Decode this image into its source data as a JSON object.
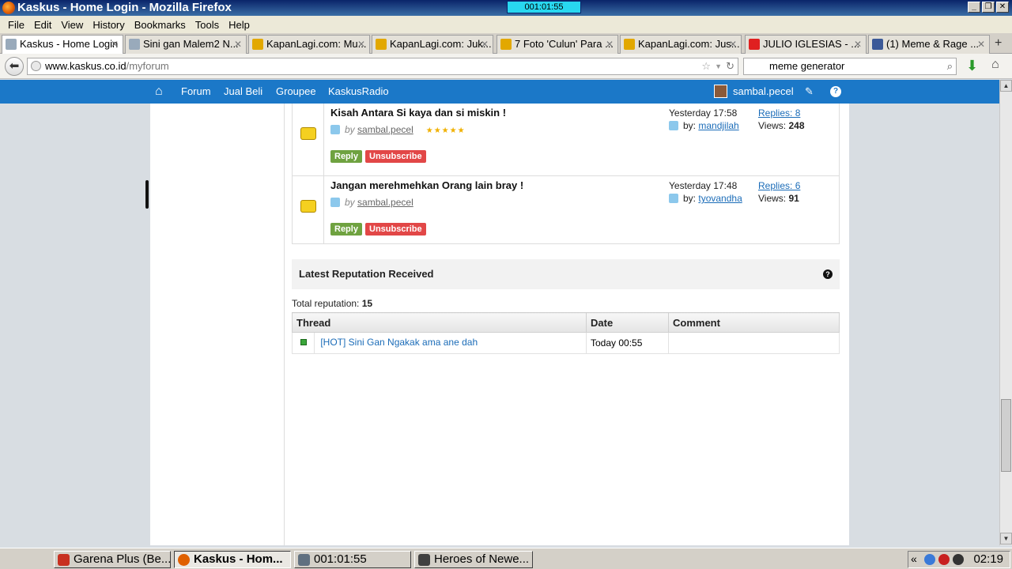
{
  "window": {
    "title": "Kaskus - Home Login - Mozilla Firefox",
    "timer": "001:01:55"
  },
  "menu": [
    "File",
    "Edit",
    "View",
    "History",
    "Bookmarks",
    "Tools",
    "Help"
  ],
  "tabs": [
    {
      "label": "Kaskus - Home Login",
      "icon": "kaskus-icon",
      "color": "#9ab"
    },
    {
      "label": "Sini gan Malem2 N...",
      "icon": "kaskus-icon",
      "color": "#9ab"
    },
    {
      "label": "KapanLagi.com: Mu...",
      "icon": "kapanlagi-icon",
      "color": "#e2a800"
    },
    {
      "label": "KapanLagi.com: Juk...",
      "icon": "kapanlagi-icon",
      "color": "#e2a800"
    },
    {
      "label": "7 Foto 'Culun' Para ...",
      "icon": "kapanlagi-icon",
      "color": "#e2a800"
    },
    {
      "label": "KapanLagi.com: Jus...",
      "icon": "kapanlagi-icon",
      "color": "#e2a800"
    },
    {
      "label": "JULIO IGLESIAS - ...",
      "icon": "youtube-icon",
      "color": "#e02020"
    },
    {
      "label": "(1) Meme & Rage ...",
      "icon": "facebook-icon",
      "color": "#3b5998"
    }
  ],
  "nav": {
    "url_host": "www.kaskus.co.id",
    "url_path": "/myforum",
    "search_value": "meme generator"
  },
  "kaskus_nav": {
    "items": [
      "Forum",
      "Jual Beli",
      "Groupee",
      "KaskusRadio"
    ],
    "username": "sambal.pecel"
  },
  "threads": [
    {
      "title": "Kisah Antara Si kaya dan si miskin !",
      "by_prefix": "by",
      "author": "sambal.pecel",
      "stars": "★★★★★",
      "reply": "Reply",
      "unsubscribe": "Unsubscribe",
      "date": "Yesterday 17:58",
      "last_by_prefix": "by:",
      "last_by": "mandjilah",
      "replies": "Replies: 8",
      "views_label": "Views:",
      "views": "248"
    },
    {
      "title": "Jangan merehmehkan Orang lain bray !",
      "by_prefix": "by",
      "author": "sambal.pecel",
      "stars": "",
      "reply": "Reply",
      "unsubscribe": "Unsubscribe",
      "date": "Yesterday 17:48",
      "last_by_prefix": "by:",
      "last_by": "tyovandha",
      "replies": "Replies: 6",
      "views_label": "Views:",
      "views": "91"
    }
  ],
  "reputation": {
    "heading": "Latest Reputation Received",
    "help": "?",
    "total_label": "Total reputation:",
    "total": "15",
    "columns": [
      "Thread",
      "Date",
      "Comment"
    ],
    "rows": [
      {
        "thread": "[HOT] Sini Gan Ngakak ama ane dah",
        "date": "Today 00:55",
        "comment": ""
      }
    ]
  },
  "taskbar": {
    "items": [
      {
        "label": "Garena Plus (Be...",
        "icon": "garena-icon",
        "color": "#c83020"
      },
      {
        "label": "Kaskus - Hom...",
        "icon": "firefox-icon",
        "color": "#e06000"
      },
      {
        "label": "001:01:55",
        "icon": "timer-icon",
        "color": "#607080"
      },
      {
        "label": "Heroes of Newe...",
        "icon": "hon-icon",
        "color": "#404040"
      }
    ],
    "tray_chevron": "«",
    "clock": "02:19"
  }
}
